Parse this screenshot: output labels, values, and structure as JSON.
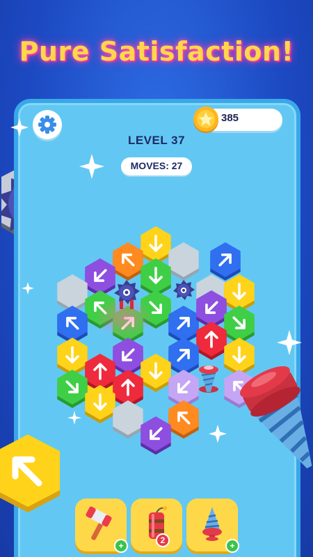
{
  "headline": "Pure Satisfaction!",
  "hud": {
    "coins": "385",
    "level": "LEVEL 37",
    "moves": "MOVES: 27"
  },
  "icons": {
    "settings": "gear-icon",
    "coin": "star-coin-icon",
    "hammer": "hammer-icon",
    "dynamite": "dynamite-icon",
    "drill": "drill-icon"
  },
  "tools": [
    {
      "name": "hammer",
      "badge": "+",
      "badge_color": "#3cc24a"
    },
    {
      "name": "dynamite",
      "badge": "2",
      "badge_color": "#e53945"
    },
    {
      "name": "drill",
      "badge": "+",
      "badge_color": "#3cc24a"
    }
  ],
  "colors": {
    "orange": "#ff8a1f",
    "yellow": "#ffd31a",
    "purple": "#8e4fe0",
    "green": "#3fcf46",
    "blue": "#2f6ff0",
    "red": "#ee2a3c",
    "lavender": "#c5a6f5",
    "empty": "#c9d4dc"
  },
  "board": [
    {
      "c": "yellow",
      "dir": "down"
    },
    {
      "c": "orange",
      "dir": "up-left"
    },
    {
      "c": "empty",
      "dir": ""
    },
    {
      "c": "blue",
      "dir": "up-right"
    },
    {
      "c": "purple",
      "dir": "down-left"
    },
    {
      "c": "green",
      "dir": "down"
    },
    {
      "c": "empty",
      "dir": ""
    },
    {
      "c": "empty",
      "dir": ""
    },
    {
      "c": "green",
      "dir": "up-left"
    },
    {
      "c": "yellow",
      "dir": "down"
    },
    {
      "c": "green",
      "dir": "down-right"
    },
    {
      "c": "blue",
      "dir": "up-right"
    },
    {
      "c": "blue",
      "dir": "up-left"
    },
    {
      "c": "purple",
      "dir": "down-left"
    },
    {
      "c": "green",
      "dir": "down-right"
    },
    {
      "c": "green",
      "dir": "up-right"
    },
    {
      "c": "red",
      "dir": "up"
    },
    {
      "c": "yellow",
      "dir": "down"
    },
    {
      "c": "yellow",
      "dir": "down"
    },
    {
      "c": "purple",
      "dir": "down-left"
    },
    {
      "c": "blue",
      "dir": "up-right"
    },
    {
      "c": "yellow",
      "dir": "down"
    },
    {
      "c": "red",
      "dir": "up"
    },
    {
      "c": "yellow",
      "dir": "down"
    },
    {
      "c": "green",
      "dir": "down-right"
    },
    {
      "c": "red",
      "dir": "up"
    },
    {
      "c": "lavender",
      "dir": "down-left"
    },
    {
      "c": "lavender",
      "dir": "up-left"
    },
    {
      "c": "yellow",
      "dir": "down"
    },
    {
      "c": "orange",
      "dir": "up-left"
    },
    {
      "c": "empty",
      "dir": ""
    },
    {
      "c": "purple",
      "dir": "down-left"
    }
  ]
}
